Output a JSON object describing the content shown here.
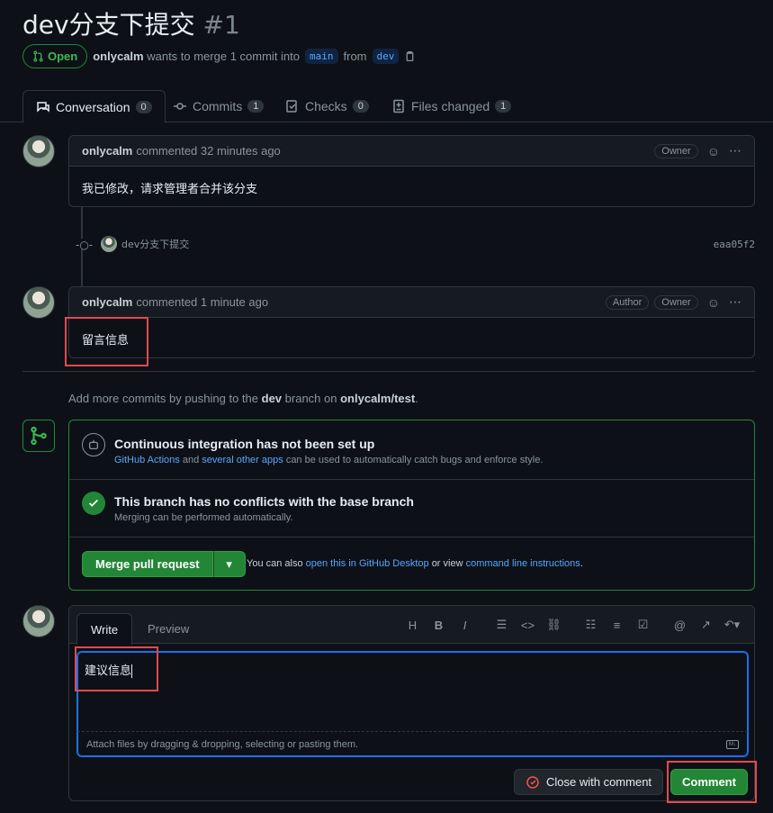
{
  "pr": {
    "title": "dev分支下提交",
    "number": "#1",
    "state": "Open",
    "author": "onlycalm",
    "meta_text": "wants to merge 1 commit into",
    "base_branch": "main",
    "from_text": "from",
    "head_branch": "dev"
  },
  "tabs": [
    {
      "label": "Conversation",
      "count": "0"
    },
    {
      "label": "Commits",
      "count": "1"
    },
    {
      "label": "Checks",
      "count": "0"
    },
    {
      "label": "Files changed",
      "count": "1"
    }
  ],
  "comments": [
    {
      "author": "onlycalm",
      "time": "commented 32 minutes ago",
      "badges": [
        "Owner"
      ],
      "body": "我已修改，请求管理者合并该分支"
    },
    {
      "author": "onlycalm",
      "time": "commented 1 minute ago",
      "badges": [
        "Author",
        "Owner"
      ],
      "body": "留言信息"
    }
  ],
  "commit": {
    "message": "dev分支下提交",
    "sha": "eaa05f2"
  },
  "push_note": {
    "prefix": "Add more commits by pushing to the",
    "branch": "dev",
    "middle": "branch on",
    "repo": "onlycalm/test",
    "suffix": "."
  },
  "merge": {
    "ci_title": "Continuous integration has not been set up",
    "ci_link1": "GitHub Actions",
    "ci_and": "and",
    "ci_link2": "several other apps",
    "ci_rest": "can be used to automatically catch bugs and enforce style.",
    "conflict_title": "This branch has no conflicts with the base branch",
    "conflict_sub": "Merging can be performed automatically.",
    "merge_button": "Merge pull request",
    "alt_prefix": "You can also",
    "alt_link1": "open this in GitHub Desktop",
    "alt_or": "or view",
    "alt_link2": "command line instructions",
    "alt_suffix": "."
  },
  "editor": {
    "write_tab": "Write",
    "preview_tab": "Preview",
    "text": "建议信息",
    "attach_hint": "Attach files by dragging & dropping, selecting or pasting them.",
    "close_button": "Close with comment",
    "comment_button": "Comment"
  },
  "colors": {
    "accent_green": "#238636",
    "link_blue": "#58a6ff",
    "highlight_red": "#e5484d",
    "bg": "#0d1117"
  }
}
